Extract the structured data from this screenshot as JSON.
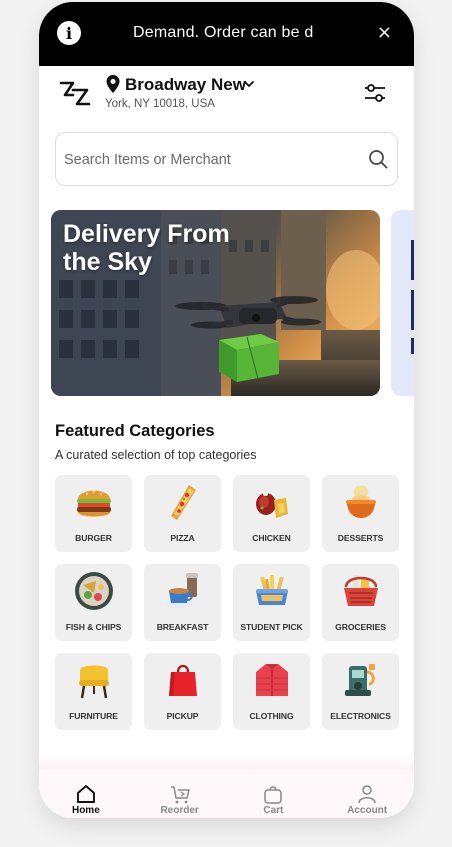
{
  "banner": {
    "message": "Demand. Order can be d",
    "close_label": "×",
    "info_label": "i"
  },
  "header": {
    "location_name": "Broadway New",
    "location_address": "York, NY 10018, USA"
  },
  "search": {
    "placeholder": "Search Items or Merchant",
    "value": ""
  },
  "hero": {
    "title": "Delivery From the Sky"
  },
  "featured": {
    "title": "Featured Categories",
    "subtitle": "A curated selection of top categories",
    "categories": [
      {
        "label": "BURGER",
        "icon": "burger-icon"
      },
      {
        "label": "PIZZA",
        "icon": "pizza-icon"
      },
      {
        "label": "CHICKEN",
        "icon": "chicken-icon"
      },
      {
        "label": "DESSERTS",
        "icon": "dessert-icon"
      },
      {
        "label": "FISH & CHIPS",
        "icon": "fish-chips-icon"
      },
      {
        "label": "BREAKFAST",
        "icon": "breakfast-icon"
      },
      {
        "label": "STUDENT PICK",
        "icon": "student-pick-icon"
      },
      {
        "label": "GROCERIES",
        "icon": "groceries-icon"
      },
      {
        "label": "FURNITURE",
        "icon": "furniture-icon"
      },
      {
        "label": "PICKUP",
        "icon": "pickup-icon"
      },
      {
        "label": "CLOTHING",
        "icon": "clothing-icon"
      },
      {
        "label": "ELECTRONICS",
        "icon": "electronics-icon"
      }
    ]
  },
  "tabs": [
    {
      "label": "Home",
      "icon": "home-icon",
      "active": true
    },
    {
      "label": "Reorder",
      "icon": "reorder-cart-icon",
      "active": false
    },
    {
      "label": "Cart",
      "icon": "bag-icon",
      "active": false
    },
    {
      "label": "Account",
      "icon": "user-icon",
      "active": false
    }
  ],
  "colors": {
    "banner_bg": "#000000",
    "tile_bg": "#efefef",
    "accent_card": "#e3e8fb"
  }
}
